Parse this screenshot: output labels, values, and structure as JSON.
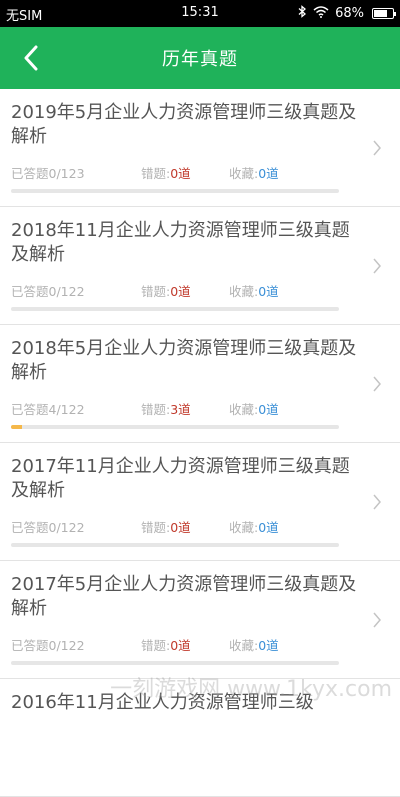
{
  "status_bar": {
    "carrier": "无SIM",
    "time": "15:31",
    "battery": "68%"
  },
  "header": {
    "title": "历年真题"
  },
  "labels": {
    "done_prefix": "已答题",
    "wrong_prefix": "错题:",
    "fav_prefix": "收藏:"
  },
  "items": [
    {
      "title": "2019年5月企业人力资源管理师三级真题及解析",
      "done": "0/123",
      "wrong": "0道",
      "fav": "0道",
      "progress": 0
    },
    {
      "title": "2018年11月企业人力资源管理师三级真题及解析",
      "done": "0/122",
      "wrong": "0道",
      "fav": "0道",
      "progress": 0
    },
    {
      "title": "2018年5月企业人力资源管理师三级真题及解析",
      "done": "4/122",
      "wrong": "3道",
      "fav": "0道",
      "progress": 0.033
    },
    {
      "title": "2017年11月企业人力资源管理师三级真题及解析",
      "done": "0/122",
      "wrong": "0道",
      "fav": "0道",
      "progress": 0
    },
    {
      "title": "2017年5月企业人力资源管理师三级真题及解析",
      "done": "0/122",
      "wrong": "0道",
      "fav": "0道",
      "progress": 0
    },
    {
      "title": "2016年11月企业人力资源管理师三级",
      "done": "",
      "wrong": "",
      "fav": "",
      "progress": 0
    }
  ],
  "watermark": "一刻游戏网 www.1kyx.com",
  "colors": {
    "header": "#1fb25a",
    "wrong": "#c0392b",
    "fav": "#3a8fd6",
    "progress": "#f5b84a"
  }
}
